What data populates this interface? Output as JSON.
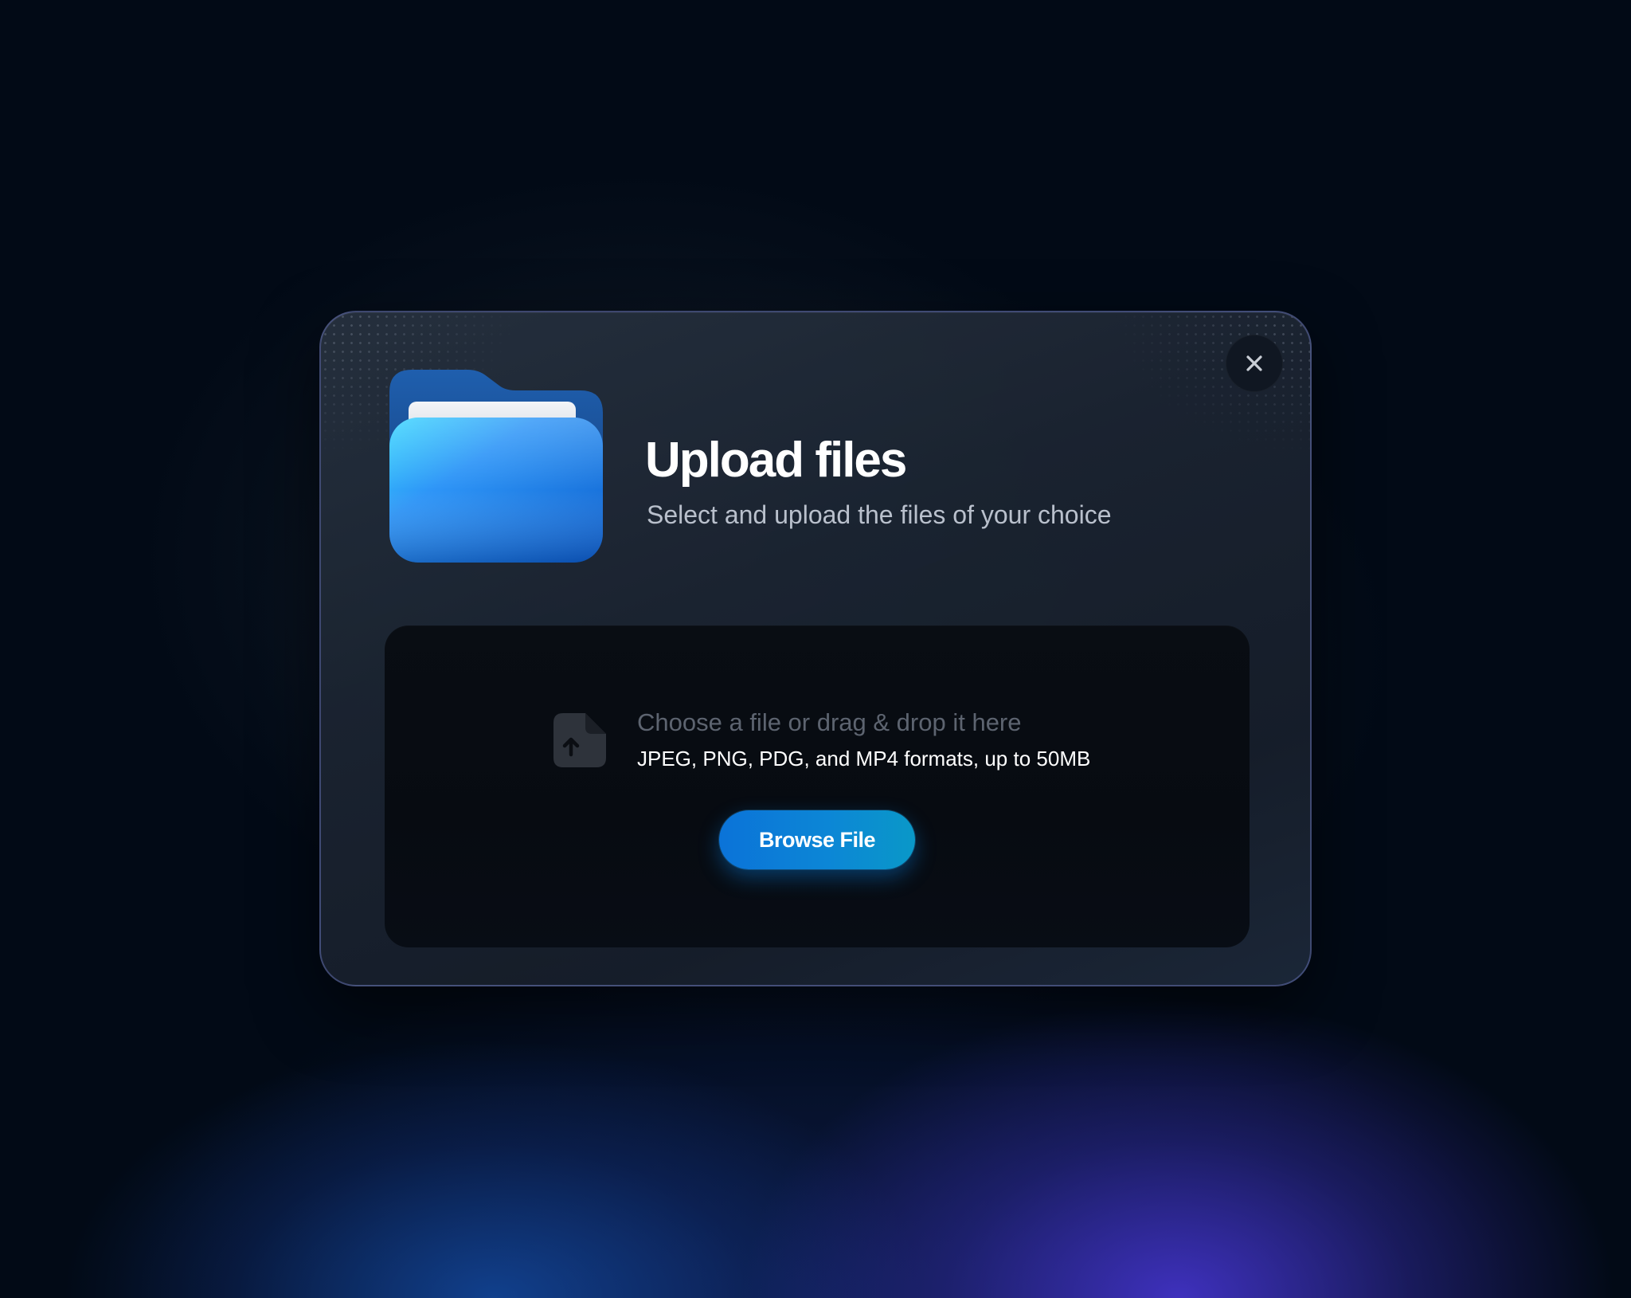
{
  "dialog": {
    "title": "Upload files",
    "subtitle": "Select and upload the files of your choice",
    "close_icon": "close-icon",
    "illustration_icon": "folder-icon"
  },
  "dropzone": {
    "icon": "file-upload-icon",
    "title": "Choose a file or drag & drop it here",
    "hint": "JPEG, PNG, PDG, and MP4 formats, up to 50MB",
    "browse_label": "Browse File"
  },
  "colors": {
    "background": "#020a16",
    "modal": "#1c2533",
    "dropzone": "#080c12",
    "accent": "#0b80d8",
    "folder_blue": "#2e8cf8",
    "title_text": "#ffffff",
    "subtitle_text": "#b9c0cc",
    "muted_text": "#5d6470"
  }
}
